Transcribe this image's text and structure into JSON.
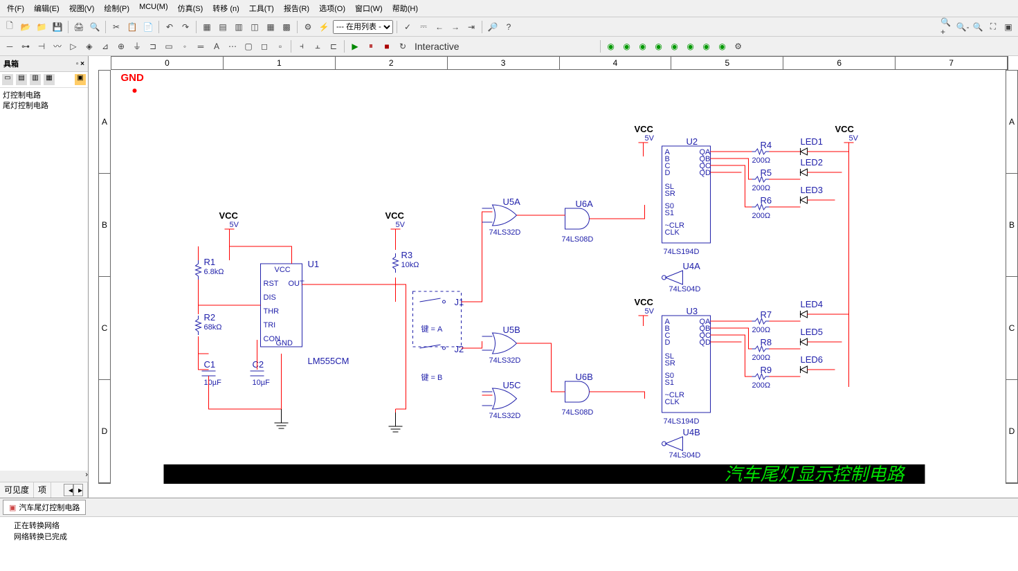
{
  "menu": {
    "file": "件(F)",
    "edit": "编辑(E)",
    "view": "视图(V)",
    "draw": "绘制(P)",
    "mcu": "MCU(M)",
    "sim": "仿真(S)",
    "transfer": "转移 (n)",
    "tools": "工具(T)",
    "report": "报告(R)",
    "options": "选项(O)",
    "window": "窗口(W)",
    "help": "帮助(H)"
  },
  "toolbar": {
    "dropdown": "--- 在用列表 -",
    "interactive": "Interactive"
  },
  "sidebar": {
    "title": "具箱",
    "items": [
      "灯控制电路",
      "尾灯控制电路"
    ],
    "tabs": {
      "visible": "可见度",
      "layer": "项"
    }
  },
  "ruler": {
    "cols": [
      "0",
      "1",
      "2",
      "3",
      "4",
      "5",
      "6",
      "7"
    ],
    "rows": [
      "A",
      "B",
      "C",
      "D"
    ]
  },
  "schematic": {
    "gnd": "GND",
    "vcc": "VCC",
    "v5": "5V",
    "u1": {
      "ref": "U1",
      "part": "LM555CM",
      "pins": {
        "vcc": "VCC",
        "rst": "RST",
        "dis": "DIS",
        "thr": "THR",
        "tri": "TRI",
        "con": "CON",
        "gnd": "GND",
        "out": "OUT"
      }
    },
    "u2": {
      "ref": "U2",
      "part": "74LS194D"
    },
    "u3": {
      "ref": "U3",
      "part": "74LS194D"
    },
    "u4a": {
      "ref": "U4A",
      "part": "74LS04D"
    },
    "u4b": {
      "ref": "U4B",
      "part": "74LS04D"
    },
    "u5a": {
      "ref": "U5A",
      "part": "74LS32D"
    },
    "u5b": {
      "ref": "U5B",
      "part": "74LS32D"
    },
    "u5c": {
      "ref": "U5C",
      "part": "74LS32D"
    },
    "u6a": {
      "ref": "U6A",
      "part": "74LS08D"
    },
    "u6b": {
      "ref": "U6B",
      "part": "74LS08D"
    },
    "r1": {
      "ref": "R1",
      "val": "6.8kΩ"
    },
    "r2": {
      "ref": "R2",
      "val": "68kΩ"
    },
    "r3": {
      "ref": "R3",
      "val": "10kΩ"
    },
    "r4": {
      "ref": "R4",
      "val": "200Ω"
    },
    "r5": {
      "ref": "R5",
      "val": "200Ω"
    },
    "r6": {
      "ref": "R6",
      "val": "200Ω"
    },
    "r7": {
      "ref": "R7",
      "val": "200Ω"
    },
    "r8": {
      "ref": "R8",
      "val": "200Ω"
    },
    "r9": {
      "ref": "R9",
      "val": "200Ω"
    },
    "c1": {
      "ref": "C1",
      "val": "10µF"
    },
    "c2": {
      "ref": "C2",
      "val": "10µF"
    },
    "j1": {
      "ref": "J1",
      "key": "键 = A"
    },
    "j2": {
      "ref": "J2",
      "key": "键 = B"
    },
    "led1": "LED1",
    "led2": "LED2",
    "led3": "LED3",
    "led4": "LED4",
    "led5": "LED5",
    "led6": "LED6",
    "shift_pins": {
      "a": "A",
      "b": "B",
      "c": "C",
      "d": "D",
      "sl": "SL",
      "sr": "SR",
      "s0": "S0",
      "s1": "S1",
      "clr": "~CLR",
      "clk": "CLK",
      "qa": "QA",
      "qb": "QB",
      "qc": "QC",
      "qd": "QD"
    },
    "title": "汽车尾灯显示控制电路"
  },
  "tab": {
    "name": "汽车尾灯控制电路"
  },
  "status": {
    "line1": "正在转换网络",
    "line2": "网络转换已完成"
  }
}
